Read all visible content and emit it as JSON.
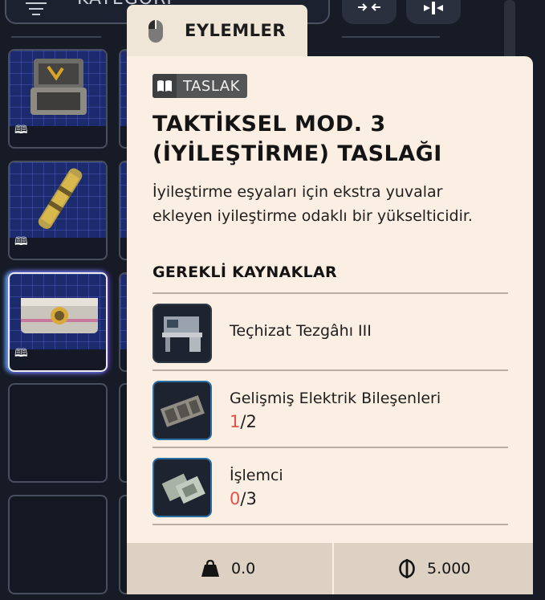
{
  "topbar": {
    "category_label": "KATEGORİ"
  },
  "inventory": {
    "book_glyph": "🕮"
  },
  "tooltip": {
    "tab_title": "EYLEMLER",
    "badge": "TASLAK",
    "title_line1": "TAKTİKSEL MOD. 3",
    "title_line2": "(İYİLEŞTİRME) TASLAĞI",
    "description": "İyileştirme eşyaları için ekstra yuvalar ekleyen iyileştirme odaklı bir yükselticidir.",
    "requirements_heading": "GEREKLİ KAYNAKLAR",
    "requirements": [
      {
        "name": "Teçhizat Tezgâhı III",
        "have": "",
        "sep": "",
        "need": "",
        "icon": "workbench-icon"
      },
      {
        "name": "Gelişmiş Elektrik Bileşenleri",
        "have": "1",
        "sep": "/",
        "need": "2",
        "icon": "electrical-components-icon"
      },
      {
        "name": "İşlemci",
        "have": "0",
        "sep": "/",
        "need": "3",
        "icon": "processor-icon"
      }
    ],
    "weight": "0.0",
    "value": "5.000"
  },
  "colors": {
    "panel_bg": "#fbeee2",
    "have_insufficient": "#e0534b",
    "slot_grid": "#1c2a6e"
  }
}
